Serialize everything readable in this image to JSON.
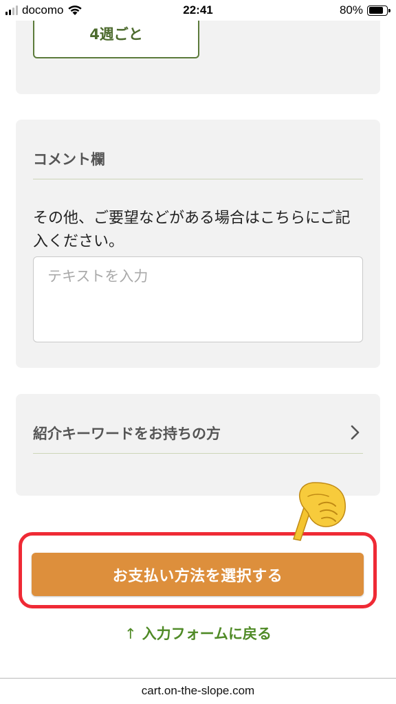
{
  "status_bar": {
    "carrier": "docomo",
    "time": "22:41",
    "battery_percent": "80%",
    "battery_level": 0.8,
    "signal_bars": 2,
    "signal_bars_total": 4
  },
  "delivery": {
    "frequency_option": "4週ごと"
  },
  "comment": {
    "title": "コメント欄",
    "description": "その他、ご要望などがある場合はこちらにご記入ください。",
    "placeholder": "テキストを入力",
    "value": ""
  },
  "referral": {
    "title": "紹介キーワードをお持ちの方"
  },
  "cta": {
    "pay_label": "お支払い方法を選択する",
    "back_arrow": "↑",
    "back_label": "入力フォームに戻る"
  },
  "browser": {
    "url": "cart.on-the-slope.com"
  },
  "colors": {
    "accent_green": "#4f8a26",
    "button_orange": "#dd8f3c",
    "highlight_red": "#ef2a35",
    "card_bg": "#f2f2f2"
  },
  "icons": [
    "signal-icon",
    "wifi-icon",
    "battery-icon",
    "chevron-right-icon",
    "pointing-hand-icon",
    "up-arrow-icon"
  ]
}
